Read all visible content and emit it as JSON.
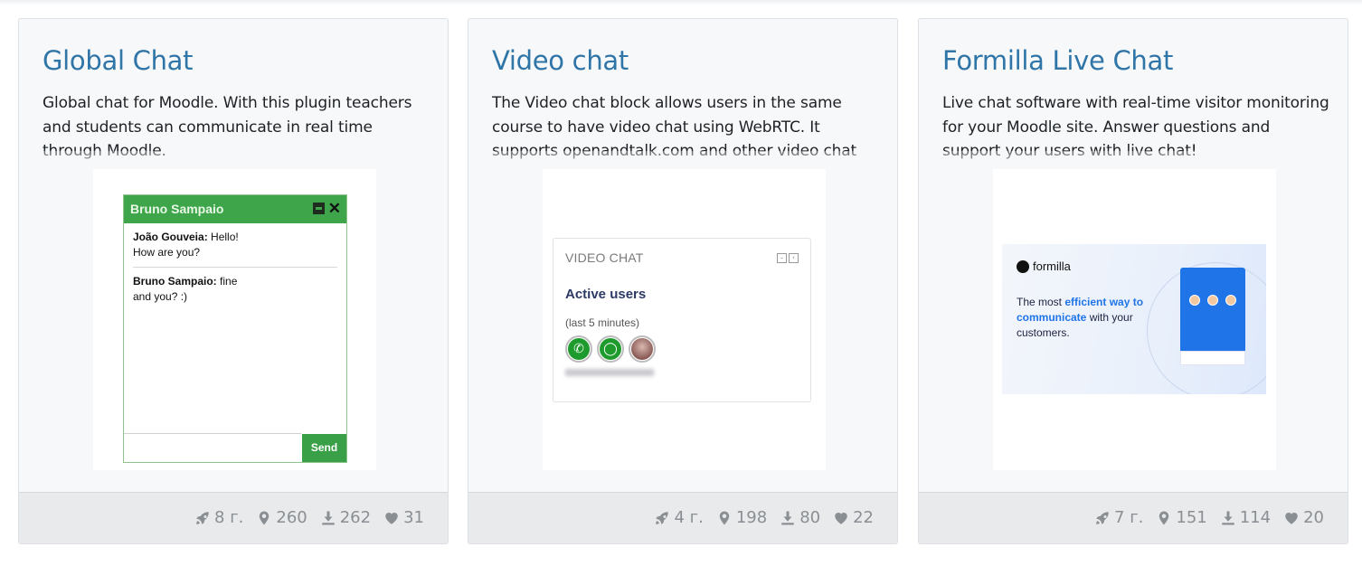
{
  "cards": [
    {
      "title": "Global Chat",
      "description": "Global chat for Moodle. With this plugin teachers and students can communicate in real time through Moodle.",
      "stats": {
        "age": "8 г.",
        "sites": "260",
        "downloads": "262",
        "favourites": "31"
      },
      "preview": {
        "header_name": "Bruno Sampaio",
        "messages": [
          {
            "sender": "João Gouveia:",
            "text": "Hello!",
            "text2": "How are you?"
          },
          {
            "sender": "Bruno Sampaio:",
            "text": "fine",
            "text2": "and you? :)"
          }
        ],
        "send_label": "Send"
      }
    },
    {
      "title": "Video chat",
      "description": "The Video chat block allows users in the same course to have video chat using WebRTC. It supports openandtalk.com and other video chat",
      "stats": {
        "age": "4 г.",
        "sites": "198",
        "downloads": "80",
        "favourites": "22"
      },
      "preview": {
        "block_title": "VIDEO CHAT",
        "heading": "Active users",
        "subheading": "(last 5 minutes)"
      }
    },
    {
      "title": "Formilla Live Chat",
      "description": "Live chat software with real-time visitor monitoring for your Moodle site. Answer questions and support your users with live chat!",
      "stats": {
        "age": "7 г.",
        "sites": "151",
        "downloads": "114",
        "favourites": "20"
      },
      "preview": {
        "brand": "formilla",
        "line1": "The most ",
        "highlight": "efficient way to communicate",
        "line2": " with your customers."
      }
    }
  ],
  "icons": [
    "rocket-icon",
    "map-marker-icon",
    "download-icon",
    "heart-icon"
  ],
  "colors": {
    "title": "#2f75a8",
    "stats": "#8a8f94",
    "card_bg": "#f7f8f9",
    "footer_bg": "#e9eaeb"
  }
}
